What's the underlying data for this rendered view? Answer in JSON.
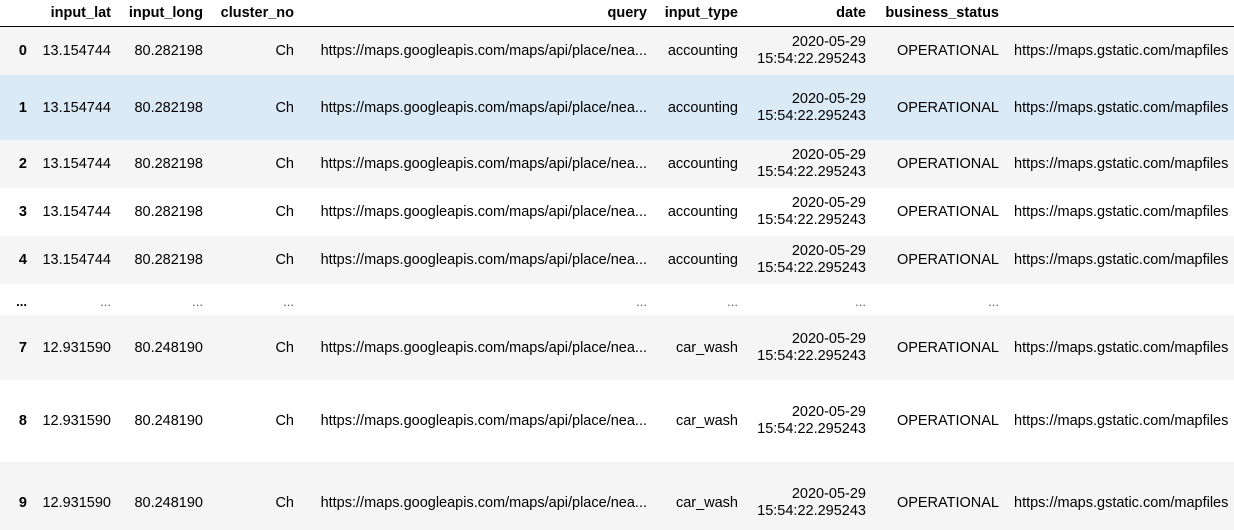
{
  "columns": {
    "input_lat": "input_lat",
    "input_long": "input_long",
    "cluster_no": "cluster_no",
    "query": "query",
    "input_type": "input_type",
    "date": "date",
    "business_status": "business_status"
  },
  "rows": [
    {
      "index": "0",
      "input_lat": "13.154744",
      "input_long": "80.282198",
      "cluster_no": "Ch",
      "query": "https://maps.googleapis.com/maps/api/place/nea...",
      "input_type": "accounting",
      "date_day": "2020-05-29",
      "date_time": "15:54:22.295243",
      "business_status": "OPERATIONAL",
      "icon": "https://maps.gstatic.com/mapfiles"
    },
    {
      "index": "1",
      "input_lat": "13.154744",
      "input_long": "80.282198",
      "cluster_no": "Ch",
      "query": "https://maps.googleapis.com/maps/api/place/nea...",
      "input_type": "accounting",
      "date_day": "2020-05-29",
      "date_time": "15:54:22.295243",
      "business_status": "OPERATIONAL",
      "icon": "https://maps.gstatic.com/mapfiles"
    },
    {
      "index": "2",
      "input_lat": "13.154744",
      "input_long": "80.282198",
      "cluster_no": "Ch",
      "query": "https://maps.googleapis.com/maps/api/place/nea...",
      "input_type": "accounting",
      "date_day": "2020-05-29",
      "date_time": "15:54:22.295243",
      "business_status": "OPERATIONAL",
      "icon": "https://maps.gstatic.com/mapfiles"
    },
    {
      "index": "3",
      "input_lat": "13.154744",
      "input_long": "80.282198",
      "cluster_no": "Ch",
      "query": "https://maps.googleapis.com/maps/api/place/nea...",
      "input_type": "accounting",
      "date_day": "2020-05-29",
      "date_time": "15:54:22.295243",
      "business_status": "OPERATIONAL",
      "icon": "https://maps.gstatic.com/mapfiles"
    },
    {
      "index": "4",
      "input_lat": "13.154744",
      "input_long": "80.282198",
      "cluster_no": "Ch",
      "query": "https://maps.googleapis.com/maps/api/place/nea...",
      "input_type": "accounting",
      "date_day": "2020-05-29",
      "date_time": "15:54:22.295243",
      "business_status": "OPERATIONAL",
      "icon": "https://maps.gstatic.com/mapfiles"
    },
    {
      "index": "7",
      "input_lat": "12.931590",
      "input_long": "80.248190",
      "cluster_no": "Ch",
      "query": "https://maps.googleapis.com/maps/api/place/nea...",
      "input_type": "car_wash",
      "date_day": "2020-05-29",
      "date_time": "15:54:22.295243",
      "business_status": "OPERATIONAL",
      "icon": "https://maps.gstatic.com/mapfiles"
    },
    {
      "index": "8",
      "input_lat": "12.931590",
      "input_long": "80.248190",
      "cluster_no": "Ch",
      "query": "https://maps.googleapis.com/maps/api/place/nea...",
      "input_type": "car_wash",
      "date_day": "2020-05-29",
      "date_time": "15:54:22.295243",
      "business_status": "OPERATIONAL",
      "icon": "https://maps.gstatic.com/mapfiles"
    },
    {
      "index": "9",
      "input_lat": "12.931590",
      "input_long": "80.248190",
      "cluster_no": "Ch",
      "query": "https://maps.googleapis.com/maps/api/place/nea...",
      "input_type": "car_wash",
      "date_day": "2020-05-29",
      "date_time": "15:54:22.295243",
      "business_status": "OPERATIONAL",
      "icon": "https://maps.gstatic.com/mapfiles"
    }
  ],
  "ellipsis": {
    "index": "...",
    "cell": "..."
  }
}
